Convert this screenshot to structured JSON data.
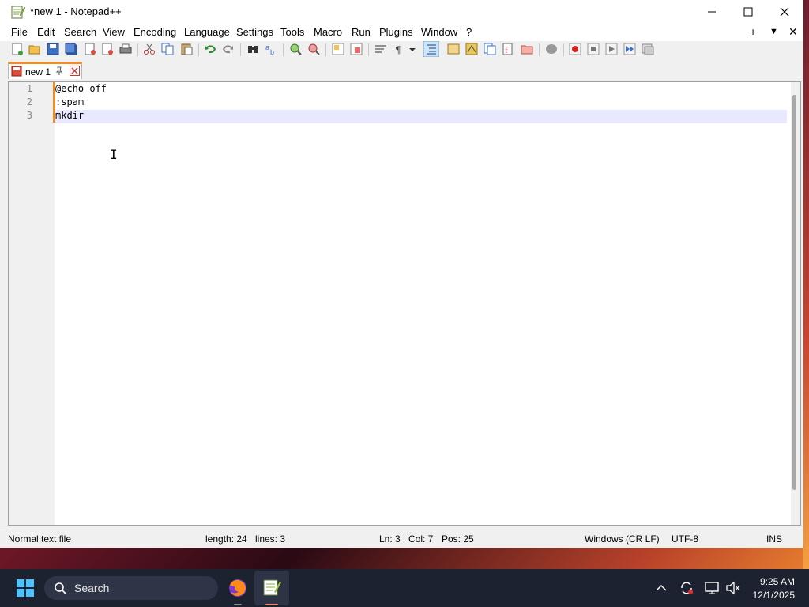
{
  "window": {
    "title": "*new 1 - Notepad++",
    "minimize_icon": "minimize-icon",
    "maximize_icon": "maximize-icon",
    "close_icon": "close-icon"
  },
  "menu": {
    "items": [
      "File",
      "Edit",
      "Search",
      "View",
      "Encoding",
      "Language",
      "Settings",
      "Tools",
      "Macro",
      "Run",
      "Plugins",
      "Window",
      "?"
    ],
    "right": [
      "+",
      "▼",
      "✕"
    ]
  },
  "toolbar": {
    "icons": [
      "new-file-icon",
      "open-file-icon",
      "save-icon",
      "save-all-icon",
      "close-icon",
      "close-all-icon",
      "print-icon",
      "cut-icon",
      "copy-icon",
      "paste-icon",
      "undo-icon",
      "redo-icon",
      "find-icon",
      "replace-icon",
      "zoom-in-icon",
      "zoom-out-icon",
      "sync-vertical-icon",
      "sync-horizontal-icon",
      "word-wrap-icon",
      "show-all-characters-icon",
      "indent-guide-icon",
      "user-language-icon",
      "doc-map-icon",
      "function-list-icon",
      "folder-as-workspace-icon",
      "monitoring-icon",
      "record-macro-icon",
      "stop-record-icon",
      "playback-macro-icon",
      "run-macro-multiple-icon",
      "save-macro-icon"
    ]
  },
  "tab": {
    "label": "new 1",
    "pin_icon": "pin-icon",
    "close_icon": "tab-close-icon"
  },
  "editor": {
    "lines": [
      {
        "num": "1",
        "text": "@echo off"
      },
      {
        "num": "2",
        "text": ":spam"
      },
      {
        "num": "3",
        "text": "mkdir"
      }
    ]
  },
  "status": {
    "file_type": "Normal text file",
    "length": "length: 24",
    "lines": "lines: 3",
    "ln": "Ln: 3",
    "col": "Col: 7",
    "pos": "Pos: 25",
    "eol": "Windows (CR LF)",
    "encoding": "UTF-8",
    "mode": "INS"
  },
  "taskbar": {
    "search_placeholder": "Search",
    "time": "9:25 AM",
    "date": "12/1/2025"
  },
  "colors": {
    "tab_accent": "#f08b2a",
    "current_line": "#e8e8ff",
    "taskbar": "#1c2230"
  }
}
